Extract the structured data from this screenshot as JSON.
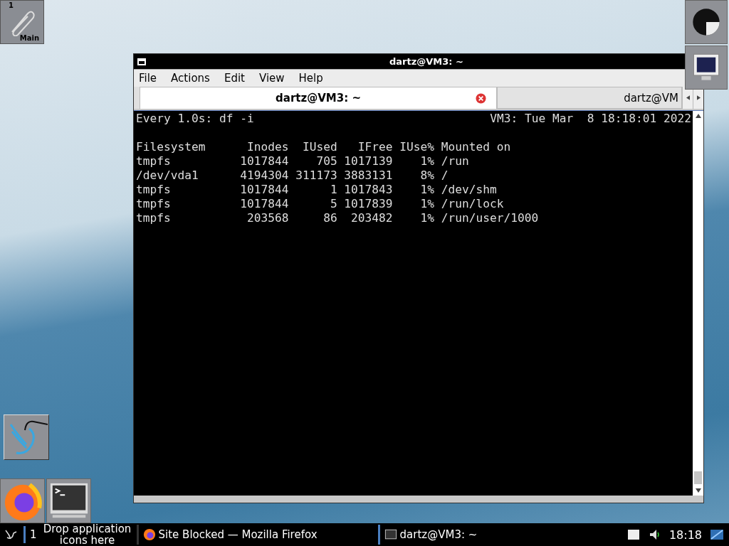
{
  "pager": {
    "number": "1",
    "label": "Main"
  },
  "window": {
    "title": "dartz@VM3: ~",
    "menu": [
      "File",
      "Actions",
      "Edit",
      "View",
      "Help"
    ],
    "tabs": [
      {
        "label": "dartz@VM3: ~",
        "selected": true
      },
      {
        "label": "dartz@VM",
        "selected": false
      }
    ],
    "terminal": {
      "header_left": "Every 1.0s: df -i",
      "header_right": "VM3: Tue Mar  8 18:18:01 2022",
      "lines": [
        "Filesystem      Inodes  IUsed   IFree IUse% Mounted on",
        "tmpfs          1017844    705 1017139    1% /run",
        "/dev/vda1      4194304 311173 3883131    8% /",
        "tmpfs          1017844      1 1017843    1% /dev/shm",
        "tmpfs          1017844      5 1017839    1% /run/lock",
        "tmpfs           203568     86  203482    1% /run/user/1000"
      ]
    }
  },
  "taskbar": {
    "workspace": "1",
    "drop_hint": "Drop application icons here",
    "tasks": [
      {
        "kind": "browser",
        "label": "Site Blocked — Mozilla Firefox"
      },
      {
        "kind": "terminal",
        "label": "dartz@VM3: ~"
      }
    ],
    "clock": "18:18"
  }
}
